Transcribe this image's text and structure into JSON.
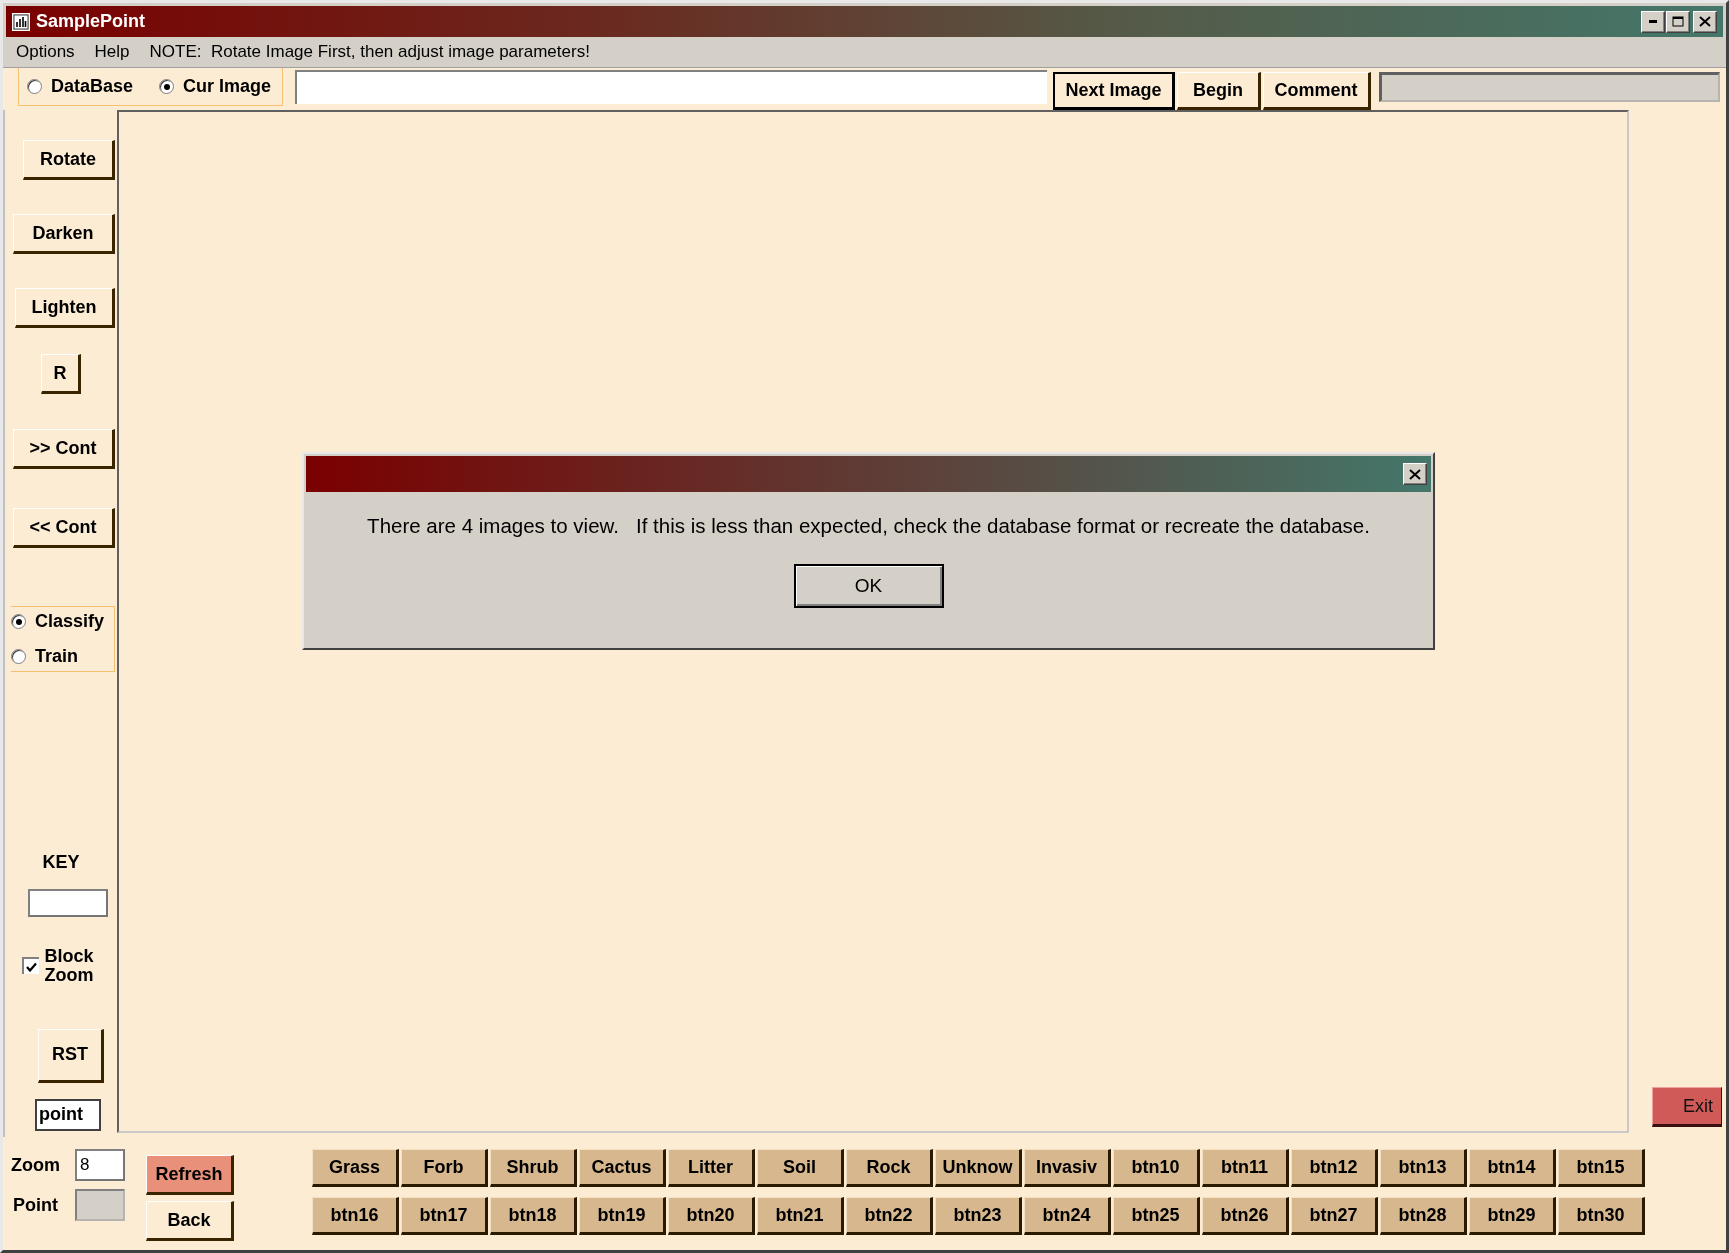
{
  "window": {
    "title": "SamplePoint"
  },
  "menu": [
    {
      "label": "Options"
    },
    {
      "label": "Help"
    }
  ],
  "note": "NOTE:  Rotate Image First, then adjust image parameters!",
  "source_options": [
    {
      "label": "DataBase",
      "selected": false
    },
    {
      "label": "Cur Image",
      "selected": true
    }
  ],
  "top_buttons": [
    {
      "label": "Next Image",
      "default": true
    },
    {
      "label": "Begin",
      "default": false
    },
    {
      "label": "Comment",
      "default": false
    }
  ],
  "side_buttons": [
    "Rotate",
    "Darken",
    "Lighten",
    "R",
    ">> Cont",
    "<< Cont"
  ],
  "mode_options": [
    {
      "label": "Classify",
      "selected": true
    },
    {
      "label": "Train",
      "selected": false
    }
  ],
  "key_label": "KEY",
  "block_zoom": {
    "label": "Block Zoom",
    "checked": true
  },
  "rst_button": "RST",
  "point_field": {
    "value": "point"
  },
  "zoom": {
    "label": "Zoom",
    "value": "8"
  },
  "point": {
    "label": "Point",
    "disabled": true
  },
  "refresh_button": "Refresh",
  "back_button": "Back",
  "exit_button": "Exit",
  "class_buttons": [
    "Grass",
    "Forb",
    "Shrub",
    "Cactus",
    "Litter",
    "Soil",
    "Rock",
    "Unknow",
    "Invasiv",
    "btn10",
    "btn11",
    "btn12",
    "btn13",
    "btn14",
    "btn15",
    "btn16",
    "btn17",
    "btn18",
    "btn19",
    "btn20",
    "btn21",
    "btn22",
    "btn23",
    "btn24",
    "btn25",
    "btn26",
    "btn27",
    "btn28",
    "btn29",
    "btn30"
  ],
  "dialog": {
    "message": "There are 4 images to view.   If this is less than expected, check the database format or recreate the database.",
    "button": "OK"
  }
}
